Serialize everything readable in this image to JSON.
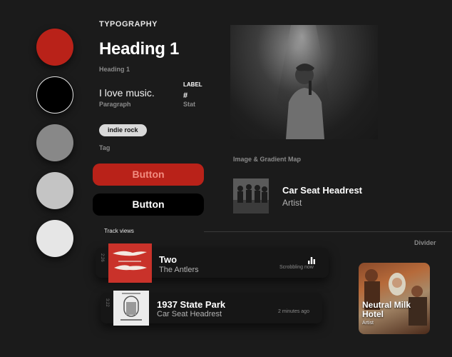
{
  "colors": [
    "#b92219",
    "#000000",
    "#888888",
    "#c4c4c4",
    "#e6e6e6"
  ],
  "typography": {
    "section_title": "TYPOGRAPHY",
    "heading_text": "Heading 1",
    "heading_label": "Heading 1",
    "paragraph_text": "I love music.",
    "paragraph_label": "Paragraph",
    "label_caption": "LABEL",
    "stat_value": "#",
    "stat_label": "Stat",
    "tag_text": "indie rock",
    "tag_label": "Tag"
  },
  "buttons": {
    "primary_label": "Button",
    "secondary_label": "Button"
  },
  "image": {
    "caption": "Image & Gradient Map"
  },
  "artist_row": {
    "name": "Car Seat Headrest",
    "subtitle": "Artist"
  },
  "divider": {
    "label": "Divider"
  },
  "track_views": {
    "label": "Track views",
    "tracks": [
      {
        "length": "2:26",
        "title": "Two",
        "artist": "The Antlers",
        "status": "Scrobbling now",
        "status_icon": "bars-icon"
      },
      {
        "length": "3:22",
        "title": "1937 State Park",
        "artist": "Car Seat Headrest",
        "status": "2 minutes ago"
      }
    ]
  },
  "album_card": {
    "title": "Neutral Milk Hotel",
    "subtitle": "Artist"
  }
}
